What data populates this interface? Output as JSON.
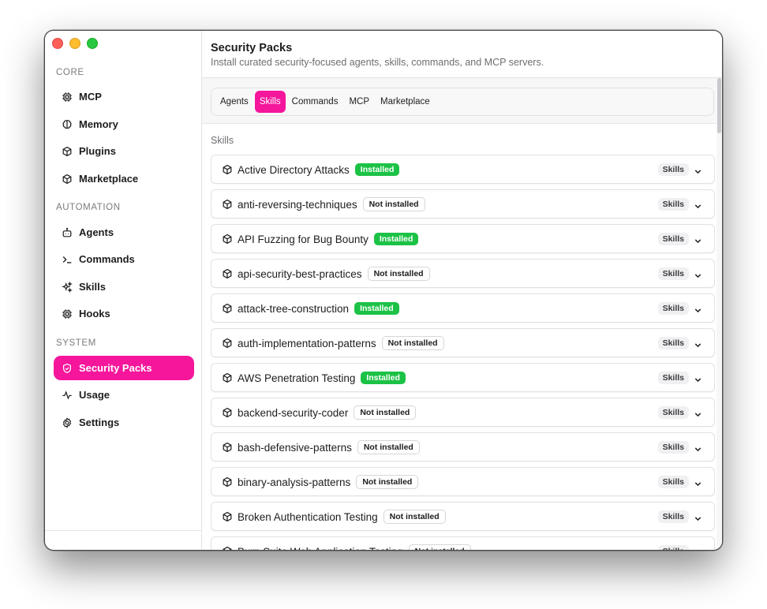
{
  "sidebar": {
    "sections": [
      {
        "label": "CORE",
        "items": [
          {
            "label": "MCP",
            "icon": "chip-icon"
          },
          {
            "label": "Memory",
            "icon": "brain-icon"
          },
          {
            "label": "Plugins",
            "icon": "package-icon"
          },
          {
            "label": "Marketplace",
            "icon": "package-icon"
          }
        ]
      },
      {
        "label": "AUTOMATION",
        "items": [
          {
            "label": "Agents",
            "icon": "bot-icon"
          },
          {
            "label": "Commands",
            "icon": "terminal-icon"
          },
          {
            "label": "Skills",
            "icon": "sparkles-icon"
          },
          {
            "label": "Hooks",
            "icon": "chip-icon"
          }
        ]
      },
      {
        "label": "SYSTEM",
        "items": [
          {
            "label": "Security Packs",
            "icon": "shield-check-icon",
            "active": true
          },
          {
            "label": "Usage",
            "icon": "activity-icon"
          },
          {
            "label": "Settings",
            "icon": "gear-icon"
          }
        ]
      }
    ]
  },
  "header": {
    "title": "Security Packs",
    "subtitle": "Install curated security-focused agents, skills, commands, and MCP servers."
  },
  "tabs": [
    {
      "label": "Agents",
      "active": false
    },
    {
      "label": "Skills",
      "active": true
    },
    {
      "label": "Commands",
      "active": false
    },
    {
      "label": "MCP",
      "active": false
    },
    {
      "label": "Marketplace",
      "active": false
    }
  ],
  "section_heading": "Skills",
  "status_labels": {
    "installed": "Installed",
    "not_installed": "Not installed"
  },
  "type_label": "Skills",
  "skills": [
    {
      "name": "Active Directory Attacks",
      "status": "Installed"
    },
    {
      "name": "anti-reversing-techniques",
      "status": "Not installed"
    },
    {
      "name": "API Fuzzing for Bug Bounty",
      "status": "Installed"
    },
    {
      "name": "api-security-best-practices",
      "status": "Not installed"
    },
    {
      "name": "attack-tree-construction",
      "status": "Installed"
    },
    {
      "name": "auth-implementation-patterns",
      "status": "Not installed"
    },
    {
      "name": "AWS Penetration Testing",
      "status": "Installed"
    },
    {
      "name": "backend-security-coder",
      "status": "Not installed"
    },
    {
      "name": "bash-defensive-patterns",
      "status": "Not installed"
    },
    {
      "name": "binary-analysis-patterns",
      "status": "Not installed"
    },
    {
      "name": "Broken Authentication Testing",
      "status": "Not installed"
    },
    {
      "name": "Burp Suite Web Application Testing",
      "status": "Not installed"
    }
  ],
  "colors": {
    "accent": "#f5169c",
    "installed": "#1cc246"
  }
}
